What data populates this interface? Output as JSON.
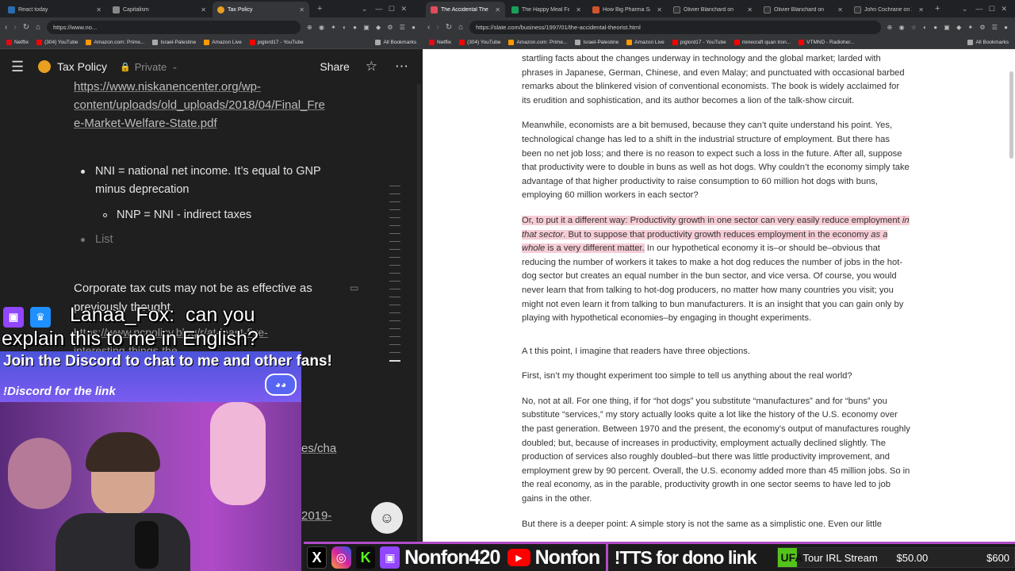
{
  "left_browser": {
    "tabs": [
      {
        "label": "React today",
        "active": false,
        "color": "#2b6cb0"
      },
      {
        "label": "Capitalism",
        "active": false,
        "color": "#888888"
      },
      {
        "label": "Tax Policy",
        "active": true,
        "color": "#e8a020"
      }
    ],
    "url": "https://www.no...",
    "bookmarks": [
      "Netflix",
      "(304) YouTube",
      "Amazon.com: Prime...",
      "Israel-Palestine",
      "Amazon Live",
      "piglord17 - YouTube"
    ],
    "all_bookmarks": "All Bookmarks"
  },
  "notion": {
    "page_title": "Tax Policy",
    "privacy": "Private",
    "share_label": "Share",
    "link_lines": [
      "https://www.niskanencenter.org/wp-",
      "content/uploads/old_uploads/2018/04/Final_Fre",
      "e-Market-Welfare-State.pdf"
    ],
    "bullet_1_line1": "NNI = national net income. It’s equal to GNP",
    "bullet_1_line2": "minus deprecation",
    "sub_bullet": "NNP = NNI - indirect taxes",
    "placeholder": "List",
    "paragraph": "Corporate tax cuts may not be as effective as",
    "paragraph_2": "previously thought",
    "link2": "https://www.ncpolicy.blog/r/at-least-five-",
    "link2b": "interesting-things-the",
    "frag1": "es/cha",
    "frag2": "2019-"
  },
  "right_browser": {
    "tabs": [
      {
        "label": "The Accidental Theo",
        "active": true,
        "color": "#e34b5c"
      },
      {
        "label": "The Happy Meal Fal",
        "active": false,
        "color": "#18a058"
      },
      {
        "label": "How Big Pharma Sa",
        "active": false,
        "color": "#d0542c"
      },
      {
        "label": "Olivier Blanchard on",
        "active": false,
        "color": "#333333"
      },
      {
        "label": "Olivier Blanchard on",
        "active": false,
        "color": "#333333"
      },
      {
        "label": "John Cochrane on X",
        "active": false,
        "color": "#333333"
      }
    ],
    "url": "https://slate.com/business/1997/01/the-accidental-theorist.html",
    "bookmarks": [
      "Netflix",
      "(304) YouTube",
      "Amazon.com: Prime...",
      "Israel-Palestine",
      "Amazon Live",
      "piglord17 - YouTube",
      "minecraft quan tron...",
      "VTMND - Radioher..."
    ],
    "all_bookmarks": "All Bookmarks"
  },
  "article": {
    "p0": "startling facts about the changes underway in technology and the global market; larded with phrases in Japanese, German, Chinese, and even Malay; and punctuated with occasional barbed remarks about the blinkered vision of conventional economists. The book is widely acclaimed for its erudition and sophistication, and its author becomes a lion of the talk-show circuit.",
    "p1": "Meanwhile, economists are a bit bemused, because they can’t quite understand his point. Yes, technological change has led to a shift in the industrial structure of employment. But there has been no net job loss; and there is no reason to expect such a loss in the future. After all, suppose that productivity were to double in buns as well as hot dogs. Why couldn’t the economy simply take advantage of that higher productivity to raise consumption to 60 million hot dogs with buns, employing 60 million workers in each sector?",
    "p2_hl_a": "Or, to put it a different way: Productivity growth in one sector can very easily reduce employment ",
    "p2_hl_em1": "in that sector",
    "p2_hl_b": ". But to suppose that productivity growth reduces employment in the economy ",
    "p2_hl_em2": "as a whole",
    "p2_hl_c": " is a very different matter.",
    "p2_rest": " In our hypothetical economy it is–or should be–obvious that reducing the number of workers it takes to make a hot dog reduces the number of jobs in the hot-dog sector but creates an equal number in the bun sector, and vice versa. Of course, you would never learn that from talking to hot-dog producers, no matter how many countries you visit; you might not even learn it from talking to bun manufacturers. It is an insight that you can gain only by playing with hypothetical economies–by engaging in thought experiments.",
    "p3": "A t this point, I imagine that readers have three objections.",
    "p4": "First, isn’t my thought experiment too simple to tell us anything about the real world?",
    "p5": "No, not at all. For one thing, if for “hot dogs” you substitute “manufactures” and for “buns” you substitute “services,” my story actually looks quite a lot like the history of the U.S. economy over the past generation. Between 1970 and the present, the economy’s output of manufactures roughly doubled; but, because of increases in productivity, employment actually declined slightly. The production of services also roughly doubled–but there was little productivity improvement, and employment grew by 90 percent. Overall, the U.S. economy added more than 45 million jobs. So in the real economy, as in the parable, productivity growth in one sector seems to have led to job gains in the other.",
    "p6": "But there is a deeper point: A simple story is not the same as a simplistic one. Even our little"
  },
  "stream": {
    "chat_user": "Lanaa_Fox:",
    "chat_msg_1": "can you",
    "chat_msg_2": "explain this to me in English?",
    "discord_banner": "Join the Discord to chat to me and other fans!",
    "discord_cmd": "!Discord for the link",
    "bottom_handle": "Nonfon420",
    "bottom_yt": "Nonfon",
    "tts": "!TTS for dono link",
    "ufa": "UFA",
    "goal_label": "Tour IRL Stream",
    "goal_current": "$50.00",
    "goal_target": "$600",
    "goal_progress": 0.083,
    "twitch_color": "#9146ff",
    "discord_color": "#5865f2"
  }
}
